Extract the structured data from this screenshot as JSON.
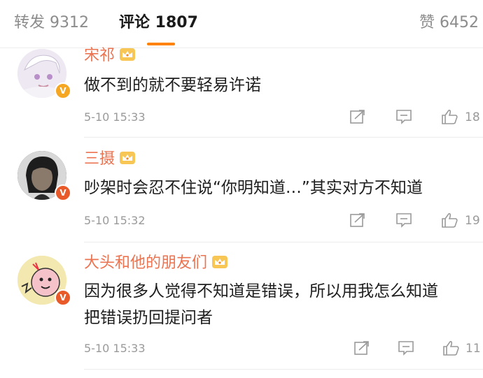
{
  "tabs": {
    "repost": "转发 9312",
    "comments": "评论 1807",
    "likes": "赞 6452"
  },
  "colors": {
    "accent": "#ff8200",
    "username": "#eb7350",
    "meta": "#9a9a9a"
  },
  "comments": [
    {
      "username": "宋祁",
      "text_lines": [
        "做不到的就不要轻易许诺"
      ],
      "time": "5-10 15:33",
      "likes": "18"
    },
    {
      "username": "三摄",
      "text_lines": [
        "吵架时会忍不住说“你明知道…”其实对方不知道"
      ],
      "time": "5-10 15:32",
      "likes": "19"
    },
    {
      "username": "大头和他的朋友们",
      "text_lines": [
        "因为很多人觉得不知道是错误，所以用我怎么知道",
        "把错误扔回提问者"
      ],
      "time": "5-10 15:33",
      "likes": "11"
    }
  ],
  "icons": [
    "crown-icon",
    "verified-badge-icon",
    "repost-icon",
    "reply-icon",
    "like-icon"
  ]
}
